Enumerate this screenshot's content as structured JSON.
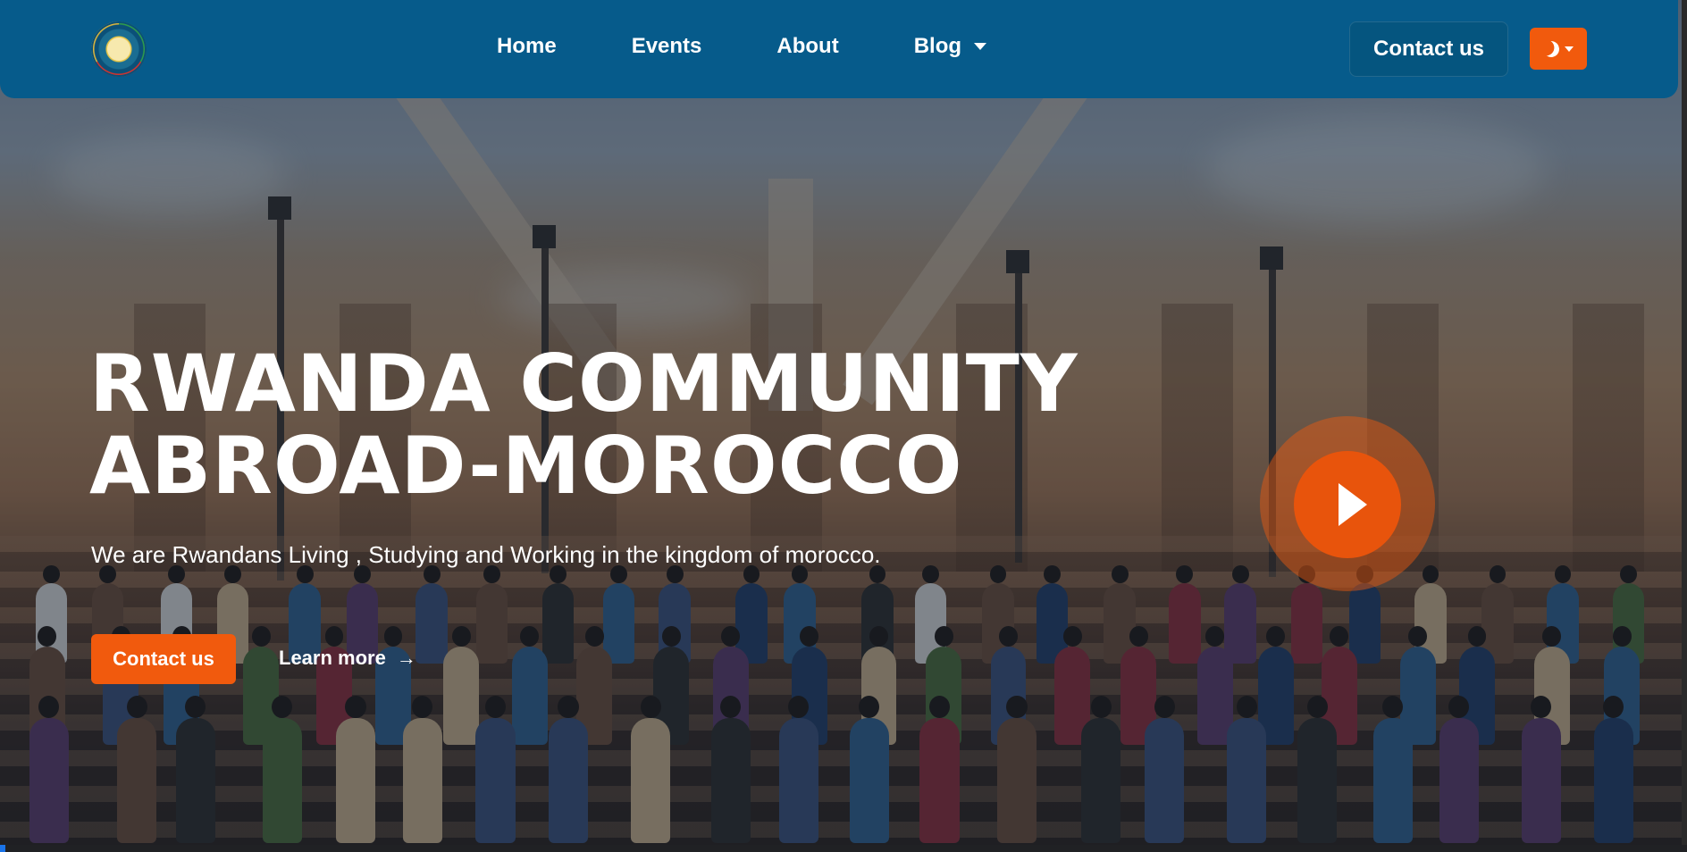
{
  "brand": {
    "logo_icon": "rwanda-community-logo"
  },
  "nav": {
    "links": [
      {
        "label": "Home"
      },
      {
        "label": "Events"
      },
      {
        "label": "About"
      },
      {
        "label": "Blog",
        "has_dropdown": true
      }
    ],
    "contact_label": "Contact us",
    "theme_toggle_icon": "moon-icon"
  },
  "hero": {
    "title_line1": "RWANDA COMMUNITY",
    "title_line2": "ABROAD-MOROCCO",
    "subtitle": "We are Rwandans Living , Studying and Working in the kingdom of morocco.",
    "primary_button": "Contact us",
    "secondary_button": "Learn more",
    "play_icon": "play-icon"
  },
  "colors": {
    "navbar_bg": "#065b8b",
    "accent": "#f15a0d",
    "text": "#ffffff"
  }
}
